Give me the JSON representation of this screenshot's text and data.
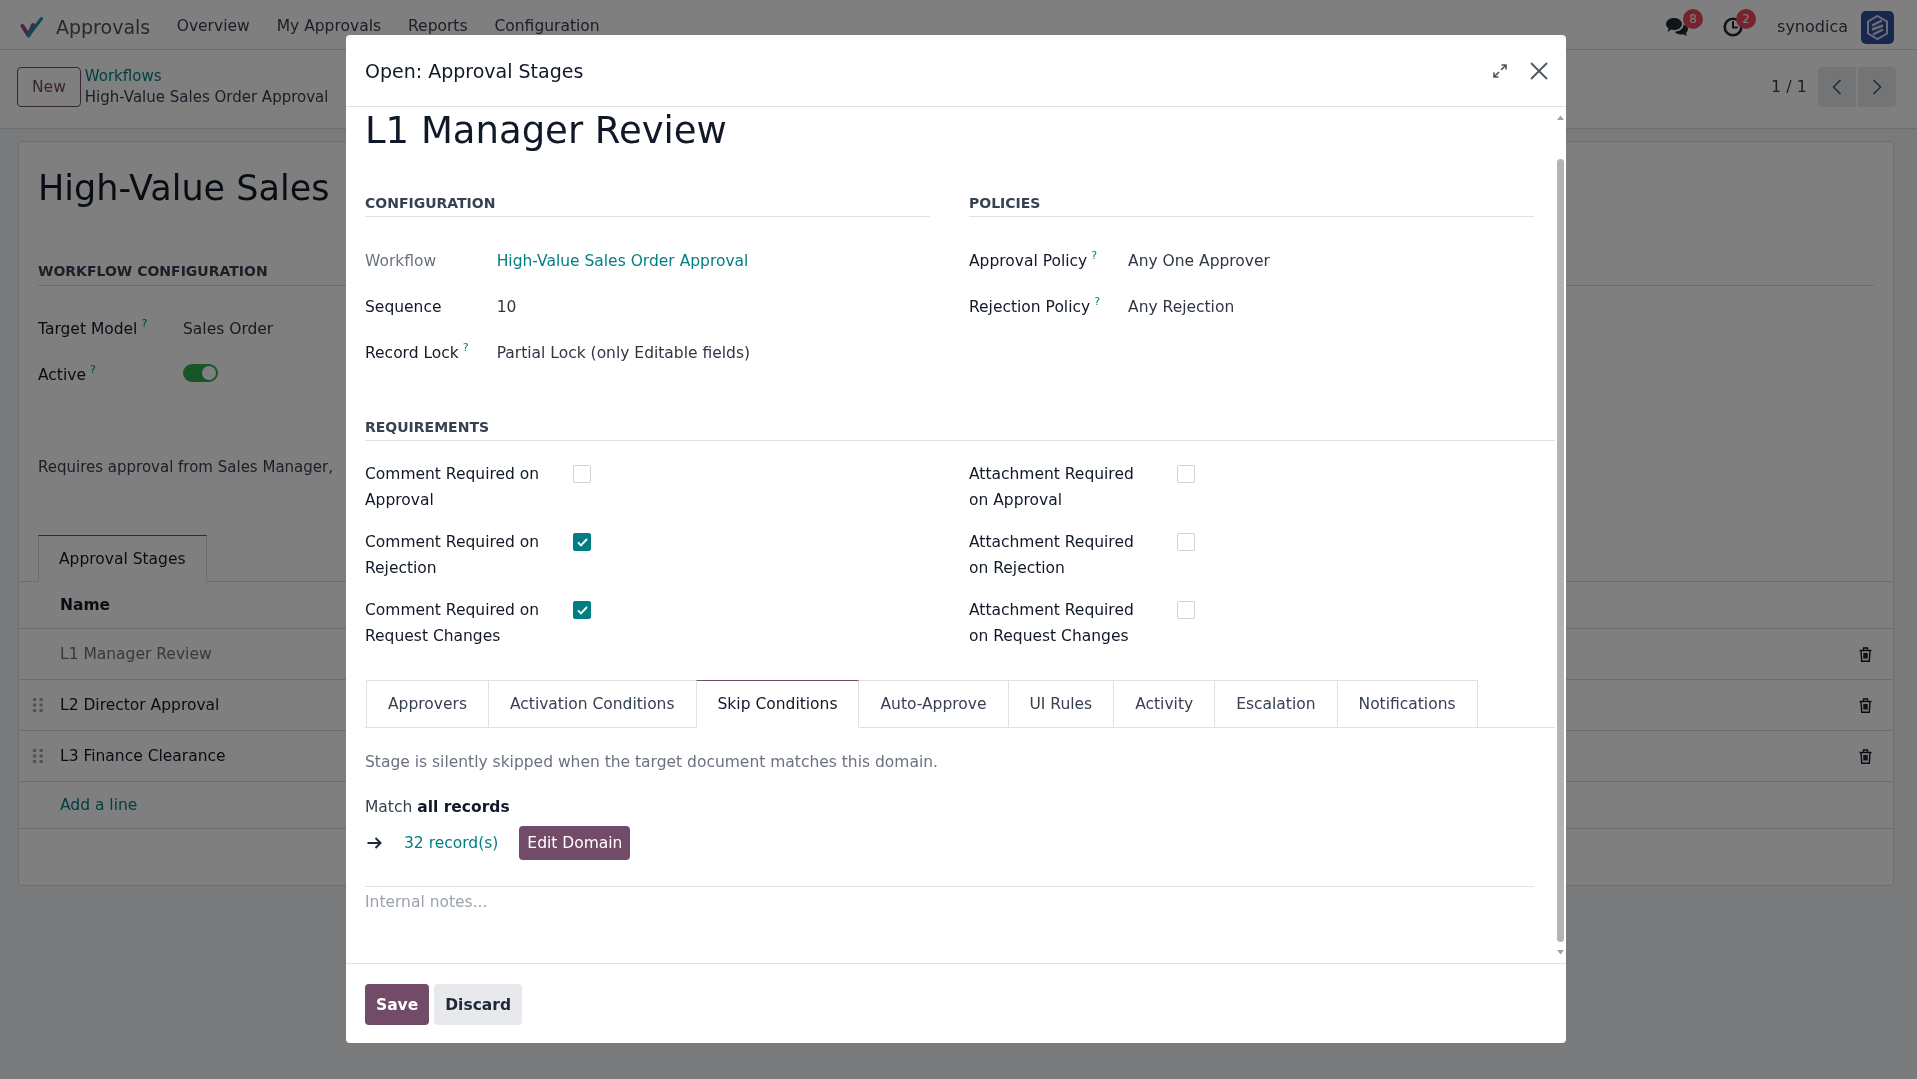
{
  "navbar": {
    "app_name": "Approvals",
    "menu": [
      {
        "label": "Overview"
      },
      {
        "label": "My Approvals"
      },
      {
        "label": "Reports"
      },
      {
        "label": "Configuration"
      }
    ],
    "messages_count": "8",
    "activities_count": "2",
    "user_name": "synodica"
  },
  "control_panel": {
    "new_button": "New",
    "breadcrumb": {
      "parent": "Workflows",
      "current": "High-Value Sales Order Approval"
    },
    "pager": "1 / 1"
  },
  "form": {
    "title": "High-Value Sales",
    "section_title": "WORKFLOW CONFIGURATION",
    "fields": [
      {
        "kind": "text",
        "label": "Target Model",
        "help": "?",
        "value": "Sales Order"
      },
      {
        "kind": "toggle",
        "label": "Active",
        "help": "?",
        "on": true
      }
    ],
    "description": "Requires approval from Sales Manager,",
    "tabs": [
      {
        "label": "Approval Stages",
        "selected": true
      }
    ],
    "stages_table": {
      "columns": [
        "Name"
      ],
      "rows": [
        {
          "name": "L1 Manager Review",
          "muted": true,
          "draggable": false
        },
        {
          "name": "L2 Director Approval",
          "muted": false,
          "draggable": true
        },
        {
          "name": "L3 Finance Clearance",
          "muted": false,
          "draggable": true
        }
      ],
      "add_line": "Add a line"
    }
  },
  "dialog": {
    "title": "Open: Approval Stages",
    "record_title": "L1 Manager Review",
    "groups": [
      {
        "title": "CONFIGURATION",
        "fields": [
          {
            "kind": "link",
            "label": "Workflow",
            "readonly": true,
            "value": "High-Value Sales Order Approval"
          },
          {
            "kind": "text",
            "label": "Sequence",
            "readonly": false,
            "value": "10"
          },
          {
            "kind": "text",
            "label": "Record Lock",
            "help": "?",
            "readonly": false,
            "value": "Partial Lock (only Editable fields)"
          }
        ]
      },
      {
        "title": "POLICIES",
        "fields": [
          {
            "kind": "text",
            "label": "Approval Policy",
            "help": "?",
            "readonly": false,
            "value": "Any One Approver"
          },
          {
            "kind": "text",
            "label": "Rejection Policy",
            "help": "?",
            "readonly": false,
            "value": "Any Rejection"
          }
        ]
      }
    ],
    "requirements": {
      "title": "REQUIREMENTS",
      "items": [
        {
          "label": "Comment Required on Approval",
          "checked": false
        },
        {
          "label": "Attachment Required on Approval",
          "checked": false
        },
        {
          "label": "Comment Required on Rejection",
          "checked": true
        },
        {
          "label": "Attachment Required on Rejection",
          "checked": false
        },
        {
          "label": "Comment Required on Request Changes",
          "checked": true
        },
        {
          "label": "Attachment Required on Request Changes",
          "checked": false
        }
      ]
    },
    "tabs": [
      {
        "label": "Approvers",
        "selected": false
      },
      {
        "label": "Activation Conditions",
        "selected": false
      },
      {
        "label": "Skip Conditions",
        "selected": true
      },
      {
        "label": "Auto-Approve",
        "selected": false
      },
      {
        "label": "UI Rules",
        "selected": false
      },
      {
        "label": "Activity",
        "selected": false
      },
      {
        "label": "Escalation",
        "selected": false
      },
      {
        "label": "Notifications",
        "selected": false
      }
    ],
    "tab_panel": {
      "hint": "Stage is silently skipped when the target document matches this domain.",
      "match": "Match **all records**",
      "records_link": "32 record(s)",
      "edit_button": "Edit Domain"
    },
    "notes": {
      "placeholder": "Internal notes..."
    },
    "buttons": [
      {
        "kind": "primary",
        "label": "Save"
      },
      {
        "kind": "secondary",
        "label": "Discard"
      }
    ]
  }
}
